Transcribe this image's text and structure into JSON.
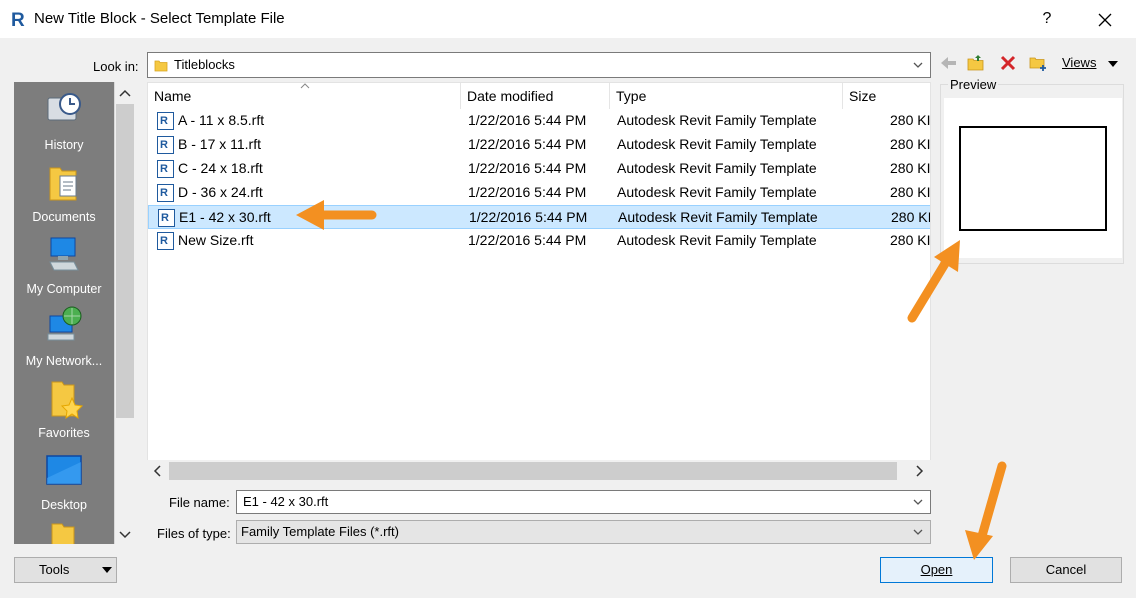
{
  "window": {
    "title": "New Title Block - Select Template File",
    "help_label": "?"
  },
  "toolbar": {
    "look_in_label": "Look in:",
    "look_in_value": "Titleblocks",
    "views_label": "Views"
  },
  "places": [
    {
      "label": "History",
      "icon": "history-icon"
    },
    {
      "label": "Documents",
      "icon": "documents-icon"
    },
    {
      "label": "My Computer",
      "icon": "computer-icon"
    },
    {
      "label": "My Network...",
      "icon": "network-icon"
    },
    {
      "label": "Favorites",
      "icon": "favorites-icon"
    },
    {
      "label": "Desktop",
      "icon": "desktop-icon"
    }
  ],
  "columns": {
    "name": "Name",
    "date": "Date modified",
    "type": "Type",
    "size": "Size"
  },
  "files": [
    {
      "name": "A - 11 x 8.5.rft",
      "date": "1/22/2016 5:44 PM",
      "type": "Autodesk Revit Family Template",
      "size": "280 KI"
    },
    {
      "name": "B - 17 x 11.rft",
      "date": "1/22/2016 5:44 PM",
      "type": "Autodesk Revit Family Template",
      "size": "280 KI"
    },
    {
      "name": "C - 24 x 18.rft",
      "date": "1/22/2016 5:44 PM",
      "type": "Autodesk Revit Family Template",
      "size": "280 KI"
    },
    {
      "name": "D - 36 x 24.rft",
      "date": "1/22/2016 5:44 PM",
      "type": "Autodesk Revit Family Template",
      "size": "280 KI"
    },
    {
      "name": "E1 - 42 x 30.rft",
      "date": "1/22/2016 5:44 PM",
      "type": "Autodesk Revit Family Template",
      "size": "280 KI"
    },
    {
      "name": "New Size.rft",
      "date": "1/22/2016 5:44 PM",
      "type": "Autodesk Revit Family Template",
      "size": "280 KI"
    }
  ],
  "selected_file_index": 4,
  "preview": {
    "label": "Preview"
  },
  "form": {
    "file_name_label": "File name:",
    "file_name_value": "E1 - 42 x 30.rft",
    "file_type_label": "Files of type:",
    "file_type_value": "Family Template Files  (*.rft)"
  },
  "buttons": {
    "tools": "Tools",
    "open": "Open",
    "cancel": "Cancel"
  },
  "colors": {
    "selection": "#cce8ff",
    "annotation_arrow": "#f39021",
    "revit_blue": "#1f5a9e"
  }
}
